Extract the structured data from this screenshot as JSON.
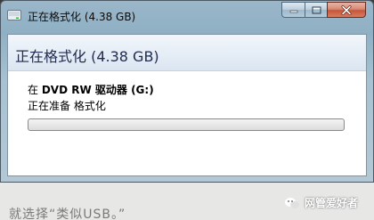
{
  "window": {
    "title": "正在格式化 (4.38 GB)"
  },
  "dialog": {
    "header_title": "正在格式化 (4.38 GB)",
    "drive_prefix": "在",
    "drive_name": "DVD RW 驱动器 (G:)",
    "status_text": "正在准备 格式化",
    "progress_value": 0
  },
  "background": {
    "caption": "就选择“类似USB。”",
    "watermark_text": "网管爱好者"
  },
  "icons": {
    "title": "disc-format-icon",
    "minimize": "minimize-icon",
    "maximize": "maximize-icon",
    "close": "close-icon",
    "watermark": "wechat-icon"
  },
  "colors": {
    "close_button": "#c6553a",
    "header_text": "#1f2b4f",
    "progress_fill": "#5bc04a"
  }
}
